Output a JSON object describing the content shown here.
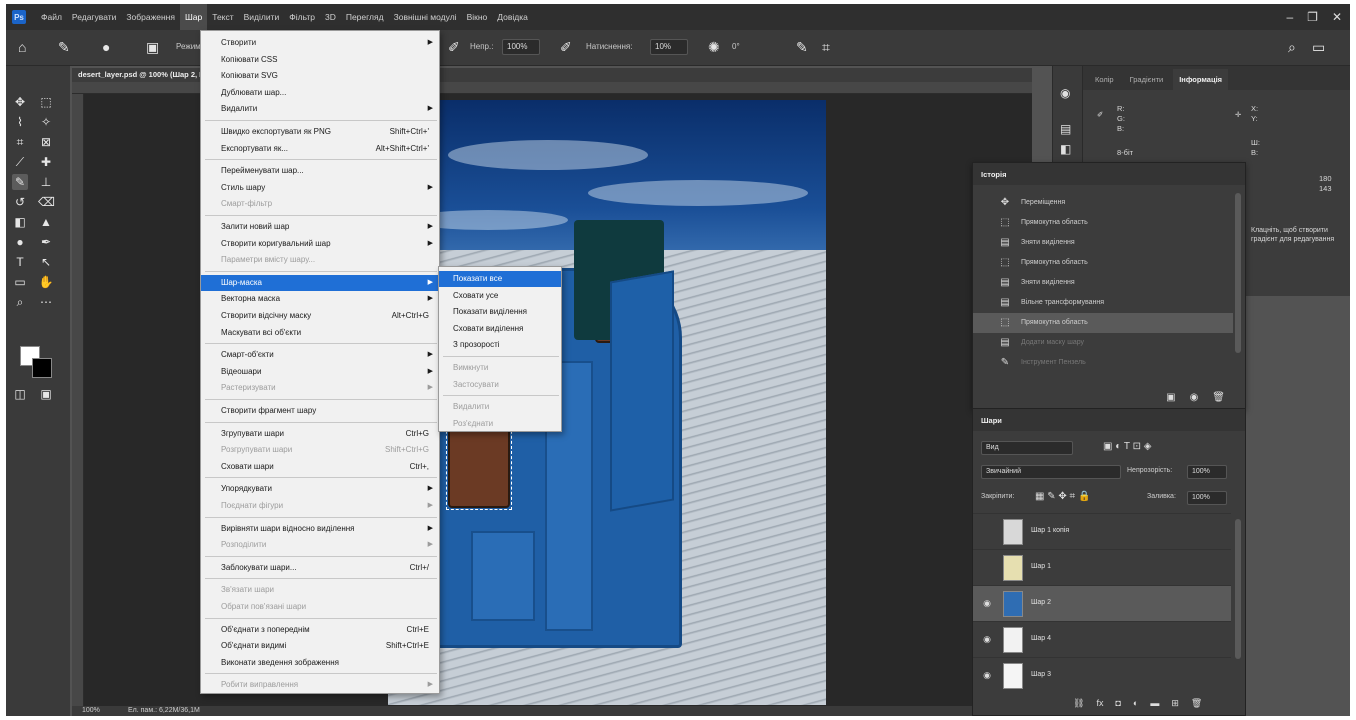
{
  "app": {
    "logo": "Ps"
  },
  "menubar": {
    "items": [
      "Файл",
      "Редагувати",
      "Зображення",
      "Шар",
      "Текст",
      "Виділити",
      "Фільтр",
      "3D",
      "Перегляд",
      "Зовнішні модулі",
      "Вікно",
      "Довідка"
    ],
    "active_index": 3
  },
  "options_bar": {
    "mode_label": "Режим:",
    "opacity_label": "Непр.:",
    "opacity_value": "100%",
    "flow_label": "Натиснення:",
    "flow_value": "10%",
    "angle_value": "0°"
  },
  "document": {
    "tab_title": "desert_layer.psd @ 100% (Шар 2, RGB/8)",
    "status_zoom": "100%",
    "status_info": "Ел. пам.: 6,22M/36,1M"
  },
  "top_panel": {
    "tabs": [
      "Колір",
      "Градієнти",
      "Інформація"
    ],
    "active_tab": 2,
    "values": [
      "R:",
      "G:",
      "B:",
      "8-біт",
      "X:",
      "Y:",
      "Ш:",
      "В:",
      "180",
      "143"
    ],
    "note": "Клацніть, щоб створити градієнт для редагування"
  },
  "history_panel": {
    "title": "Історія",
    "items": [
      {
        "label": "Переміщення",
        "icon": "move-icon",
        "glyph": "✥"
      },
      {
        "label": "Прямокутна область",
        "icon": "marquee-icon",
        "glyph": "⬚"
      },
      {
        "label": "Зняти виділення",
        "icon": "document-icon",
        "glyph": "▤"
      },
      {
        "label": "Прямокутна область",
        "icon": "marquee-icon",
        "glyph": "⬚"
      },
      {
        "label": "Зняти виділення",
        "icon": "document-icon",
        "glyph": "▤"
      },
      {
        "label": "Вільне трансформування",
        "icon": "document-icon",
        "glyph": "▤"
      },
      {
        "label": "Прямокутна область",
        "icon": "marquee-icon",
        "glyph": "⬚"
      },
      {
        "label": "Додати маску шару",
        "icon": "document-icon",
        "glyph": "▤"
      },
      {
        "label": "Інструмент Пензель",
        "icon": "brush-icon",
        "glyph": "✎"
      }
    ],
    "current_index": 6
  },
  "layers_panel": {
    "title": "Шари",
    "filter_label": "Вид",
    "blend_mode": "Звичайний",
    "opacity_label": "Непрозорість:",
    "opacity_value": "100%",
    "lock_label": "Закріпити:",
    "fill_label": "Заливка:",
    "fill_value": "100%",
    "layers": [
      {
        "name": "Шар 1 копія",
        "visible": false,
        "thumb": "#d8d8d8"
      },
      {
        "name": "Шар 1",
        "visible": false,
        "thumb": "#e6dfb0"
      },
      {
        "name": "Шар 2",
        "visible": true,
        "thumb": "#2f6db3"
      },
      {
        "name": "Шар 4",
        "visible": true,
        "thumb": "#f2f2f2"
      },
      {
        "name": "Шар 3",
        "visible": true,
        "thumb": "#f5f5f5"
      }
    ],
    "selected_index": 2
  },
  "layer_menu": {
    "items": [
      {
        "label": "Створити",
        "arrow": true
      },
      {
        "label": "Копіювати CSS"
      },
      {
        "label": "Копіювати SVG"
      },
      {
        "label": "Дублювати шар..."
      },
      {
        "label": "Видалити",
        "arrow": true
      },
      {
        "label": "Швидко експортувати як PNG",
        "shortcut": "Shift+Ctrl+'"
      },
      {
        "label": "Експортувати як...",
        "shortcut": "Alt+Shift+Ctrl+'"
      },
      {
        "label": "Перейменувати шар..."
      },
      {
        "label": "Стиль шару",
        "arrow": true
      },
      {
        "label": "Смарт-фільтр",
        "disabled": true
      },
      {
        "label": "Залити новий шар",
        "arrow": true
      },
      {
        "label": "Створити коригувальний шар",
        "arrow": true
      },
      {
        "label": "Параметри вмісту шару...",
        "disabled": true
      },
      {
        "label": "Шар-маска",
        "arrow": true,
        "highlighted": true
      },
      {
        "label": "Векторна маска",
        "arrow": true
      },
      {
        "label": "Створити відсічну маску",
        "shortcut": "Alt+Ctrl+G"
      },
      {
        "label": "Маскувати всі об'єкти"
      },
      {
        "label": "Смарт-об'єкти",
        "arrow": true
      },
      {
        "label": "Відеошари",
        "arrow": true
      },
      {
        "label": "Растеризувати",
        "arrow": true,
        "disabled": true
      },
      {
        "label": "Створити фрагмент шару"
      },
      {
        "label": "Згрупувати шари",
        "shortcut": "Ctrl+G"
      },
      {
        "label": "Розгрупувати шари",
        "shortcut": "Shift+Ctrl+G",
        "disabled": true
      },
      {
        "label": "Сховати шари",
        "shortcut": "Ctrl+,"
      },
      {
        "label": "Упорядкувати",
        "arrow": true
      },
      {
        "label": "Поєднати фігури",
        "arrow": true,
        "disabled": true
      },
      {
        "label": "Вирівняти шари відносно виділення",
        "arrow": true
      },
      {
        "label": "Розподілити",
        "arrow": true,
        "disabled": true
      },
      {
        "label": "Заблокувати шари...",
        "shortcut": "Ctrl+/"
      },
      {
        "label": "Зв'язати шари",
        "disabled": true
      },
      {
        "label": "Обрати пов'язані шари",
        "disabled": true
      },
      {
        "label": "Об'єднати з попереднім",
        "shortcut": "Ctrl+E"
      },
      {
        "label": "Об'єднати видимі",
        "shortcut": "Shift+Ctrl+E"
      },
      {
        "label": "Виконати зведення зображення"
      },
      {
        "label": "Робити виправлення",
        "arrow": true,
        "disabled": true
      }
    ]
  },
  "mask_submenu": {
    "items": [
      {
        "label": "Показати все",
        "highlighted": true
      },
      {
        "label": "Сховати усе"
      },
      {
        "label": "Показати виділення"
      },
      {
        "label": "Сховати виділення"
      },
      {
        "label": "З прозорості"
      },
      {
        "label": "Вимкнути",
        "disabled": true
      },
      {
        "label": "Застосувати",
        "disabled": true
      },
      {
        "label": "Видалити",
        "disabled": true
      },
      {
        "label": "Роз'єднати",
        "disabled": true
      }
    ]
  }
}
